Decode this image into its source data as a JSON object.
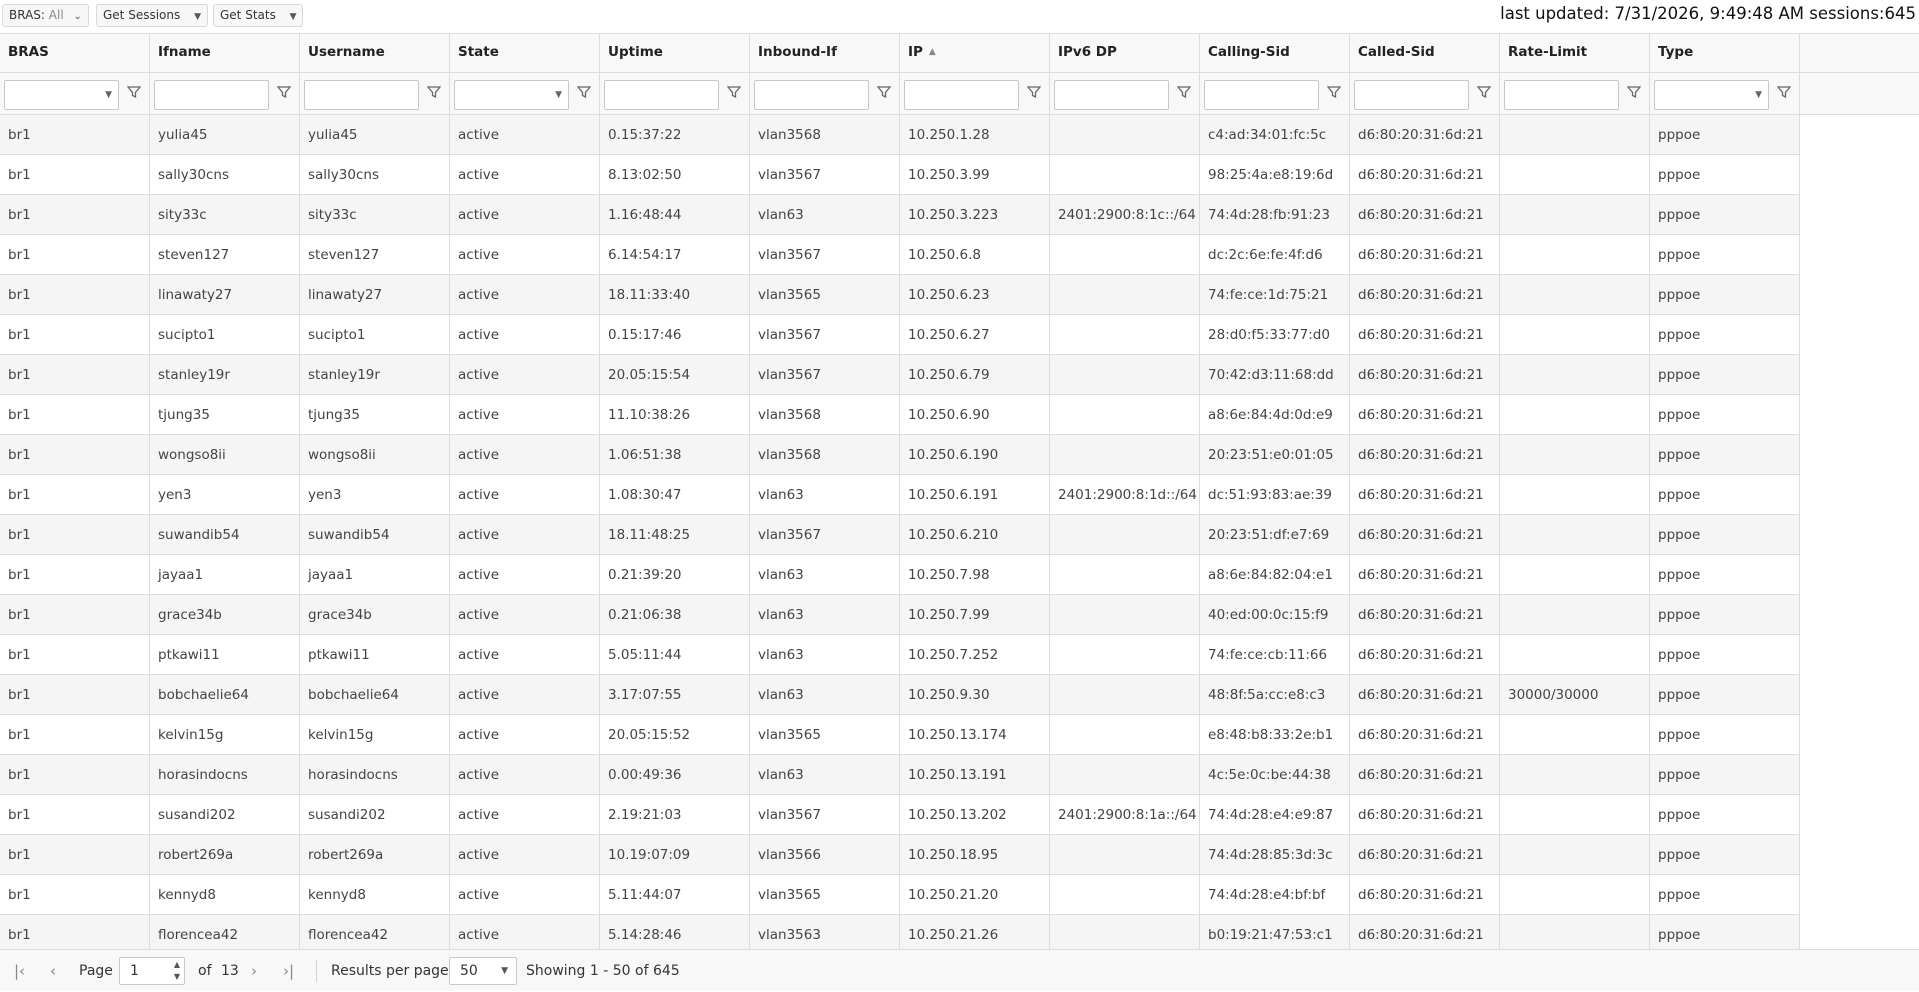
{
  "toolbar": {
    "bras_prefix": "BRAS:",
    "bras_value": "All",
    "get_sessions": "Get Sessions",
    "get_stats": "Get Stats",
    "status": "last updated: 7/31/2026, 9:49:48 AM sessions:645"
  },
  "columns": [
    "BRAS",
    "Ifname",
    "Username",
    "State",
    "Uptime",
    "Inbound-If",
    "IP",
    "IPv6 DP",
    "Calling-Sid",
    "Called-Sid",
    "Rate-Limit",
    "Type"
  ],
  "rows": [
    [
      "br1",
      "yulia45",
      "yulia45",
      "active",
      "0.15:37:22",
      "vlan3568",
      "10.250.1.28",
      "",
      "c4:ad:34:01:fc:5c",
      "d6:80:20:31:6d:21",
      "",
      "pppoe"
    ],
    [
      "br1",
      "sally30cns",
      "sally30cns",
      "active",
      "8.13:02:50",
      "vlan3567",
      "10.250.3.99",
      "",
      "98:25:4a:e8:19:6d",
      "d6:80:20:31:6d:21",
      "",
      "pppoe"
    ],
    [
      "br1",
      "sity33c",
      "sity33c",
      "active",
      "1.16:48:44",
      "vlan63",
      "10.250.3.223",
      "2401:2900:8:1c::/64",
      "74:4d:28:fb:91:23",
      "d6:80:20:31:6d:21",
      "",
      "pppoe"
    ],
    [
      "br1",
      "steven127",
      "steven127",
      "active",
      "6.14:54:17",
      "vlan3567",
      "10.250.6.8",
      "",
      "dc:2c:6e:fe:4f:d6",
      "d6:80:20:31:6d:21",
      "",
      "pppoe"
    ],
    [
      "br1",
      "linawaty27",
      "linawaty27",
      "active",
      "18.11:33:40",
      "vlan3565",
      "10.250.6.23",
      "",
      "74:fe:ce:1d:75:21",
      "d6:80:20:31:6d:21",
      "",
      "pppoe"
    ],
    [
      "br1",
      "sucipto1",
      "sucipto1",
      "active",
      "0.15:17:46",
      "vlan3567",
      "10.250.6.27",
      "",
      "28:d0:f5:33:77:d0",
      "d6:80:20:31:6d:21",
      "",
      "pppoe"
    ],
    [
      "br1",
      "stanley19r",
      "stanley19r",
      "active",
      "20.05:15:54",
      "vlan3567",
      "10.250.6.79",
      "",
      "70:42:d3:11:68:dd",
      "d6:80:20:31:6d:21",
      "",
      "pppoe"
    ],
    [
      "br1",
      "tjung35",
      "tjung35",
      "active",
      "11.10:38:26",
      "vlan3568",
      "10.250.6.90",
      "",
      "a8:6e:84:4d:0d:e9",
      "d6:80:20:31:6d:21",
      "",
      "pppoe"
    ],
    [
      "br1",
      "wongso8ii",
      "wongso8ii",
      "active",
      "1.06:51:38",
      "vlan3568",
      "10.250.6.190",
      "",
      "20:23:51:e0:01:05",
      "d6:80:20:31:6d:21",
      "",
      "pppoe"
    ],
    [
      "br1",
      "yen3",
      "yen3",
      "active",
      "1.08:30:47",
      "vlan63",
      "10.250.6.191",
      "2401:2900:8:1d::/64",
      "dc:51:93:83:ae:39",
      "d6:80:20:31:6d:21",
      "",
      "pppoe"
    ],
    [
      "br1",
      "suwandib54",
      "suwandib54",
      "active",
      "18.11:48:25",
      "vlan3567",
      "10.250.6.210",
      "",
      "20:23:51:df:e7:69",
      "d6:80:20:31:6d:21",
      "",
      "pppoe"
    ],
    [
      "br1",
      "jayaa1",
      "jayaa1",
      "active",
      "0.21:39:20",
      "vlan63",
      "10.250.7.98",
      "",
      "a8:6e:84:82:04:e1",
      "d6:80:20:31:6d:21",
      "",
      "pppoe"
    ],
    [
      "br1",
      "grace34b",
      "grace34b",
      "active",
      "0.21:06:38",
      "vlan63",
      "10.250.7.99",
      "",
      "40:ed:00:0c:15:f9",
      "d6:80:20:31:6d:21",
      "",
      "pppoe"
    ],
    [
      "br1",
      "ptkawi11",
      "ptkawi11",
      "active",
      "5.05:11:44",
      "vlan63",
      "10.250.7.252",
      "",
      "74:fe:ce:cb:11:66",
      "d6:80:20:31:6d:21",
      "",
      "pppoe"
    ],
    [
      "br1",
      "bobchaelie64",
      "bobchaelie64",
      "active",
      "3.17:07:55",
      "vlan63",
      "10.250.9.30",
      "",
      "48:8f:5a:cc:e8:c3",
      "d6:80:20:31:6d:21",
      "30000/30000",
      "pppoe"
    ],
    [
      "br1",
      "kelvin15g",
      "kelvin15g",
      "active",
      "20.05:15:52",
      "vlan3565",
      "10.250.13.174",
      "",
      "e8:48:b8:33:2e:b1",
      "d6:80:20:31:6d:21",
      "",
      "pppoe"
    ],
    [
      "br1",
      "horasindocns",
      "horasindocns",
      "active",
      "0.00:49:36",
      "vlan63",
      "10.250.13.191",
      "",
      "4c:5e:0c:be:44:38",
      "d6:80:20:31:6d:21",
      "",
      "pppoe"
    ],
    [
      "br1",
      "susandi202",
      "susandi202",
      "active",
      "2.19:21:03",
      "vlan3567",
      "10.250.13.202",
      "2401:2900:8:1a::/64",
      "74:4d:28:e4:e9:87",
      "d6:80:20:31:6d:21",
      "",
      "pppoe"
    ],
    [
      "br1",
      "robert269a",
      "robert269a",
      "active",
      "10.19:07:09",
      "vlan3566",
      "10.250.18.95",
      "",
      "74:4d:28:85:3d:3c",
      "d6:80:20:31:6d:21",
      "",
      "pppoe"
    ],
    [
      "br1",
      "kennyd8",
      "kennyd8",
      "active",
      "5.11:44:07",
      "vlan3565",
      "10.250.21.20",
      "",
      "74:4d:28:e4:bf:bf",
      "d6:80:20:31:6d:21",
      "",
      "pppoe"
    ],
    [
      "br1",
      "florencea42",
      "florencea42",
      "active",
      "5.14:28:46",
      "vlan3563",
      "10.250.21.26",
      "",
      "b0:19:21:47:53:c1",
      "d6:80:20:31:6d:21",
      "",
      "pppoe"
    ]
  ],
  "pager": {
    "page_label": "Page",
    "page_value": "1",
    "of_label": "of",
    "total_pages": "13",
    "results_label": "Results per page",
    "per_page": "50",
    "showing": "Showing 1 - 50 of 645"
  },
  "icons": {
    "first": "first-page-icon",
    "prev": "prev-page-icon",
    "next": "next-page-icon",
    "last": "last-page-icon",
    "filter": "filter-icon",
    "sort": "sort-ascending-icon"
  }
}
